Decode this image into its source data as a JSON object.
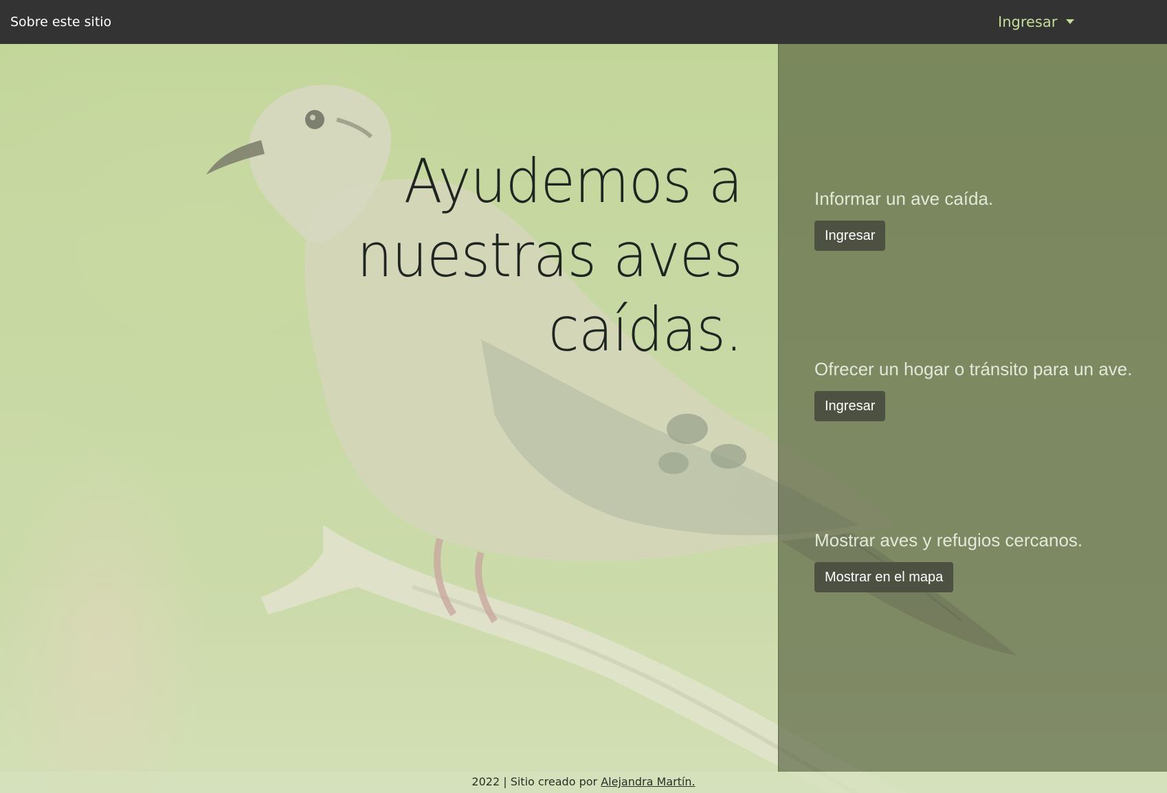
{
  "navbar": {
    "brand": "Sobre este sitio",
    "dropdown_label": "Ingresar"
  },
  "hero": {
    "headline_lines": [
      "Ayudemos a",
      "nuestras aves",
      "caídas."
    ]
  },
  "actions": [
    {
      "text": "Informar un ave caída.",
      "button": "Ingresar"
    },
    {
      "text": "Ofrecer un hogar o tránsito para un ave.",
      "button": "Ingresar"
    },
    {
      "text": "Mostrar aves y refugios cercanos.",
      "button": "Mostrar en el mapa"
    }
  ],
  "footer": {
    "prefix": "2022 | Sitio creado por ",
    "author": "Alejandra Martín."
  },
  "colors": {
    "navbar_bg": "#333333",
    "dropdown_text": "#c5dc9a",
    "button_bg": "#4c5142",
    "headline": "#1f2520"
  }
}
